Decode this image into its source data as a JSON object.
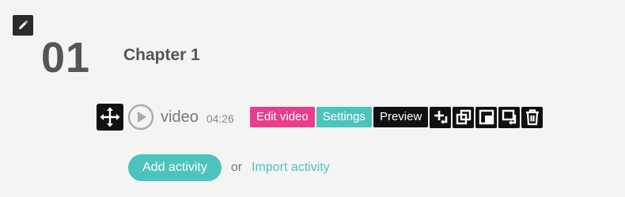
{
  "chapter": {
    "number": "01",
    "title": "Chapter 1"
  },
  "activity": {
    "name": "video",
    "duration": "04:26",
    "edit_label": "Edit video",
    "settings_label": "Settings",
    "preview_label": "Preview",
    "icons": [
      "move-icon",
      "play-icon",
      "insert-after-icon",
      "duplicate-icon",
      "copy-to-icon",
      "move-down-icon",
      "delete-icon"
    ]
  },
  "footer": {
    "add_activity_label": "Add activity",
    "or_text": "or",
    "import_label": "Import activity"
  },
  "colors": {
    "background": "#f4f4f4",
    "accent_pink": "#e83e8c",
    "accent_teal": "#4dc4bb",
    "dark": "#111111",
    "heading": "#555555"
  }
}
